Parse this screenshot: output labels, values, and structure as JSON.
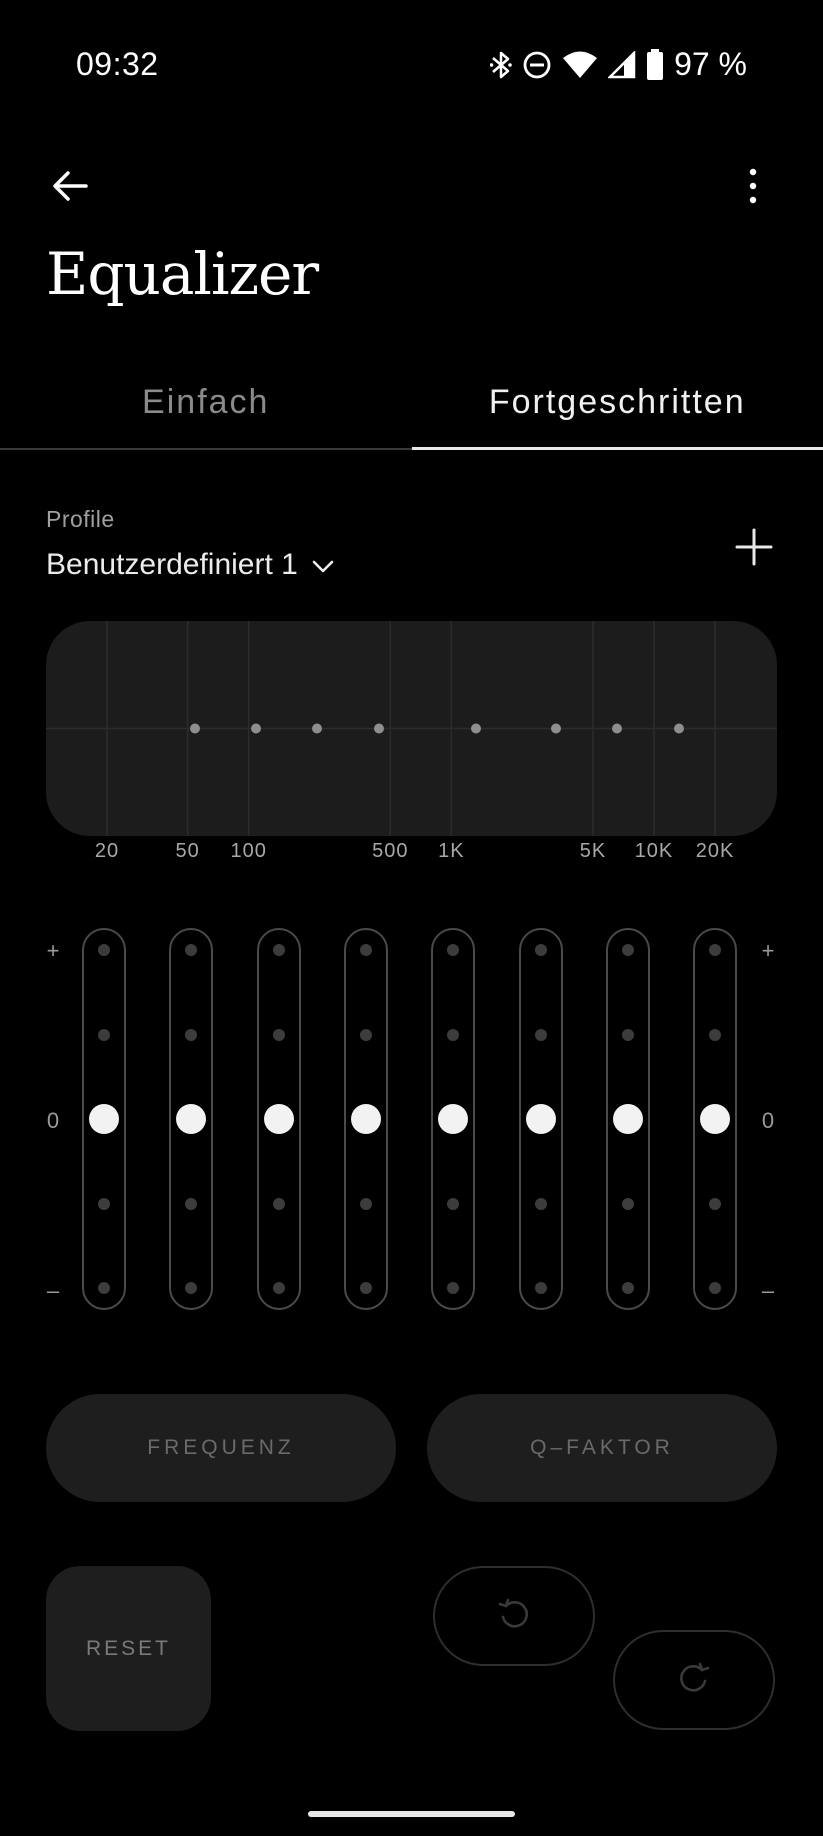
{
  "status_bar": {
    "time": "09:32",
    "battery_text": "97 %",
    "icons": [
      "bluetooth-icon",
      "do-not-disturb-icon",
      "wifi-icon",
      "cellular-signal-icon",
      "battery-icon"
    ]
  },
  "app_bar": {
    "back_icon": "arrow-left-icon",
    "menu_icon": "more-vert-icon",
    "title": "Equalizer"
  },
  "tabs": [
    {
      "label": "Einfach",
      "active": false
    },
    {
      "label": "Fortgeschritten",
      "active": true
    }
  ],
  "profile": {
    "label": "Profile",
    "selected": "Benutzerdefiniert 1",
    "add_icon": "plus-icon"
  },
  "graph": {
    "frequency_labels": [
      "20",
      "50",
      "100",
      "500",
      "1K",
      "5K",
      "10K",
      "20K"
    ]
  },
  "sliders": {
    "plus_label": "+",
    "zero_label": "0",
    "minus_label": "–",
    "bands": [
      {
        "gain": 0
      },
      {
        "gain": 0
      },
      {
        "gain": 0
      },
      {
        "gain": 0
      },
      {
        "gain": 0
      },
      {
        "gain": 0
      },
      {
        "gain": 0
      },
      {
        "gain": 0
      }
    ]
  },
  "buttons": {
    "frequency": "FREQUENZ",
    "q_factor": "Q–FAKTOR",
    "reset": "RESET",
    "undo_icon": "undo-icon",
    "redo_icon": "redo-icon"
  },
  "colors": {
    "background": "#000000",
    "panel": "#1c1c1d",
    "knob": "#f2f2f2"
  }
}
